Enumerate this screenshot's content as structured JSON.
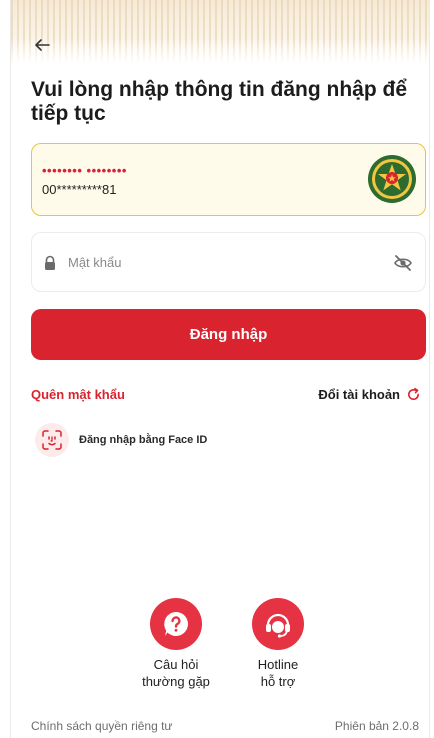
{
  "header": {
    "back_icon": "arrow-left-icon",
    "title": "Vui lòng nhập thông tin đăng nhập để tiếp tục"
  },
  "account": {
    "masked_name": "•••••••• ••••••••",
    "masked_number": "00*********81",
    "emblem_icon": "police-emblem-icon"
  },
  "password": {
    "placeholder": "Mật khẩu",
    "lock_icon": "lock-icon",
    "toggle_icon": "eye-off-icon"
  },
  "actions": {
    "login_label": "Đăng nhập",
    "forgot_label": "Quên mật khẩu",
    "switch_label": "Đổi tài khoản",
    "switch_icon": "refresh-icon",
    "faceid_label": "Đăng nhập bằng Face ID",
    "faceid_icon": "face-id-icon"
  },
  "support": {
    "faq_line1": "Câu hỏi",
    "faq_line2": "thường gặp",
    "faq_icon": "question-bubble-icon",
    "hotline_line1": "Hotline",
    "hotline_line2": "hỗ trợ",
    "hotline_icon": "support-agent-icon"
  },
  "footer": {
    "privacy_label": "Chính sách quyền riêng tư",
    "version_label": "Phiên bản 2.0.8"
  },
  "colors": {
    "primary": "#d9232e",
    "card_border": "#e8c24a",
    "card_bg": "#fffbea"
  }
}
